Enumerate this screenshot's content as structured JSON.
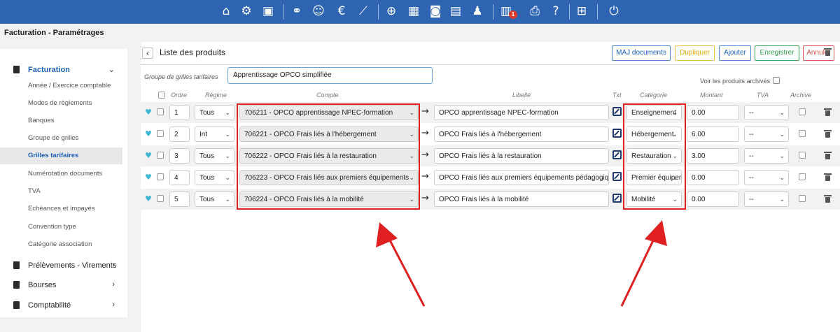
{
  "topbar": {
    "icons": [
      "home-icon",
      "gears-icon",
      "school-icon",
      "handshake-icon",
      "users-icon",
      "euro-icon",
      "chart-icon",
      "globe-icon",
      "calendar-icon",
      "car-icon",
      "id-card-icon",
      "user-clock-icon",
      "document-icon",
      "printer-icon",
      "help-icon",
      "medical-box-icon",
      "power-icon"
    ],
    "badge": "1",
    "euro": "€",
    "help": "?"
  },
  "breadcrumb": "Facturation - Paramétrages",
  "sidebar": {
    "facturation": "Facturation",
    "items": [
      {
        "label": "Année / Exercice comptable"
      },
      {
        "label": "Modes de règlements"
      },
      {
        "label": "Banques"
      },
      {
        "label": "Groupe de grilles"
      },
      {
        "label": "Grilles tarifaires"
      },
      {
        "label": "Numérotation documents"
      },
      {
        "label": "TVA"
      },
      {
        "label": "Echéances et impayés"
      },
      {
        "label": "Convention type"
      },
      {
        "label": "Catégorie association"
      }
    ],
    "sections": [
      "Prélèvements - Virements",
      "Bourses",
      "Comptabilité"
    ],
    "active_item": "Grilles tarifaires"
  },
  "panel": {
    "title": "Liste des produits",
    "buttons": {
      "maj": "MAJ documents",
      "dupliquer": "Dupliquer",
      "ajouter": "Ajouter",
      "enregistrer": "Enregistrer",
      "annuler": "Annuler"
    },
    "group_label": "Groupe de grilles tarifaires",
    "group_value": "Apprentissage OPCO simplifiée",
    "archived_label": "Voir les produits archivés"
  },
  "table": {
    "headers": {
      "ordre": "Ordre",
      "regime": "Régime",
      "compte": "Compte",
      "libelle": "Libellé",
      "txt": "Txt",
      "categorie": "Catégorie",
      "montant": "Montant",
      "tva": "TVA",
      "archive": "Archive"
    },
    "rows": [
      {
        "ordre": "1",
        "regime": "Tous",
        "compte": "706211 - OPCO apprentissage NPEC-formation",
        "libelle": "OPCO apprentissage NPEC-formation",
        "categorie": "Enseignement",
        "montant": "0.00",
        "tva": "--"
      },
      {
        "ordre": "2",
        "regime": "Int",
        "compte": "706221 - OPCO Frais liés à l'hébergement",
        "libelle": "OPCO Frais liés à l'hébergement",
        "categorie": "Hébergement",
        "montant": "6.00",
        "tva": "--"
      },
      {
        "ordre": "3",
        "regime": "Tous",
        "compte": "706222 - OPCO Frais liés à la restauration",
        "libelle": "OPCO Frais liés à la restauration",
        "categorie": "Restauration",
        "montant": "3.00",
        "tva": "--"
      },
      {
        "ordre": "4",
        "regime": "Tous",
        "compte": "706223 - OPCO Frais liés aux premiers équipements",
        "libelle": "OPCO Frais liés aux premiers équipements pédagogiques",
        "categorie": "Premier équipement",
        "montant": "0.00",
        "tva": "--"
      },
      {
        "ordre": "5",
        "regime": "Tous",
        "compte": "706224 - OPCO Frais liés à la mobilité",
        "libelle": "OPCO Frais liés à la mobilité",
        "categorie": "Mobilité",
        "montant": "0.00",
        "tva": "--"
      }
    ]
  },
  "annotations": {
    "color": "#e02020"
  }
}
